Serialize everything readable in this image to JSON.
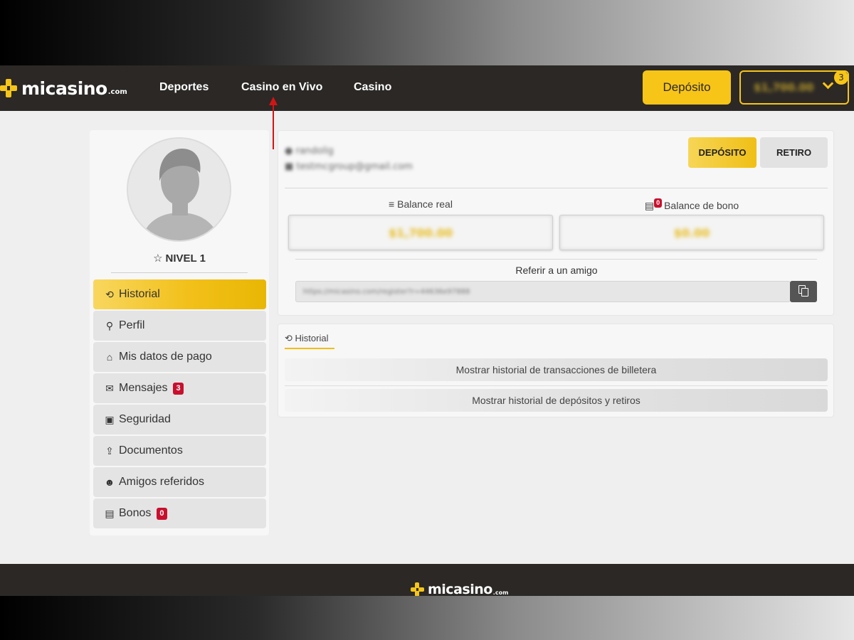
{
  "header": {
    "logo_text": "micasino",
    "logo_suffix": ".com",
    "nav": [
      "Deportes",
      "Casino en Vivo",
      "Casino"
    ],
    "deposit_button": "Depósito",
    "balance": "$1,700.00",
    "notification_count": "3"
  },
  "colors": {
    "brand_yellow": "#f7c517",
    "header_bg": "#2b2826",
    "badge_red": "#c8102e",
    "annotation_arrow": "#d31414"
  },
  "sidebar": {
    "level": "NIVEL 1",
    "items": [
      {
        "label": "Historial",
        "icon": "history-icon",
        "badge": ""
      },
      {
        "label": "Perfil",
        "icon": "user-icon",
        "badge": ""
      },
      {
        "label": "Mis datos de pago",
        "icon": "bank-icon",
        "badge": ""
      },
      {
        "label": "Mensajes",
        "icon": "envelope-icon",
        "badge": "3"
      },
      {
        "label": "Seguridad",
        "icon": "lock-icon",
        "badge": ""
      },
      {
        "label": "Documentos",
        "icon": "upload-icon",
        "badge": ""
      },
      {
        "label": "Amigos referidos",
        "icon": "users-icon",
        "badge": ""
      },
      {
        "label": "Bonos",
        "icon": "gift-icon",
        "badge": "0"
      }
    ]
  },
  "account": {
    "username": "randolig",
    "email": "testmcgroup@gmail.com",
    "tab_deposit": "DEPÓSITO",
    "tab_withdraw": "RETIRO",
    "real_balance_label": "Balance real",
    "real_balance_value": "$1,700.00",
    "bonus_balance_label": "Balance de bono",
    "bonus_badge": "0",
    "bonus_balance_value": "$0.00",
    "referral_label": "Referir a un amigo",
    "referral_link": "https://micasino.com/register?r=44636e97888"
  },
  "history": {
    "tab_label": "Historial",
    "rows": [
      "Mostrar historial de transacciones de billetera",
      "Mostrar historial de depósitos y retiros"
    ]
  },
  "footer": {
    "logo_text": "micasino",
    "logo_suffix": ".com"
  }
}
